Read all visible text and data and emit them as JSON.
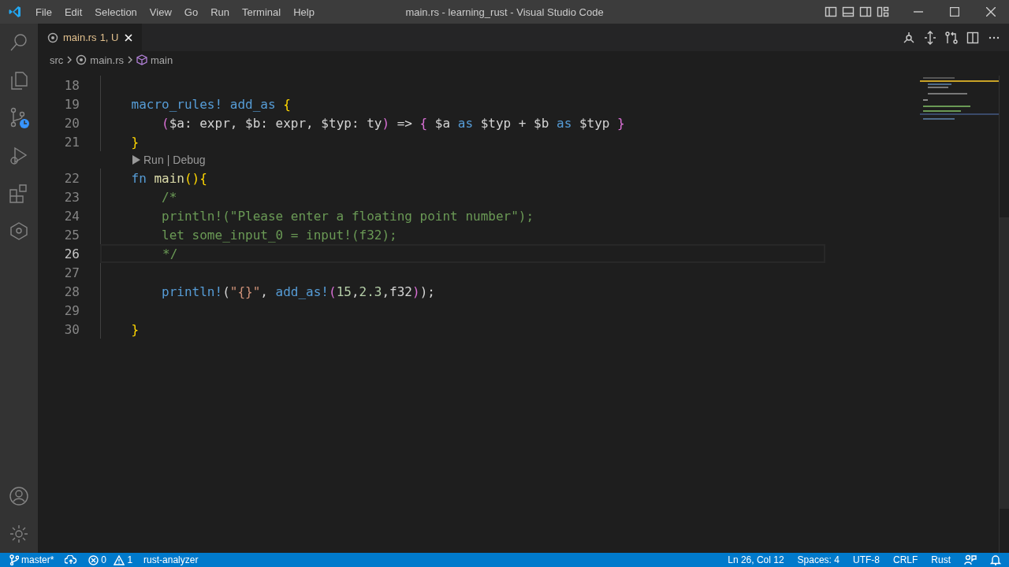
{
  "window": {
    "title": "main.rs - learning_rust - Visual Studio Code"
  },
  "menu": [
    "File",
    "Edit",
    "Selection",
    "View",
    "Go",
    "Run",
    "Terminal",
    "Help"
  ],
  "activity_bar": {
    "top": [
      {
        "kind": "search"
      },
      {
        "kind": "files"
      },
      {
        "kind": "scm"
      },
      {
        "kind": "debug"
      },
      {
        "kind": "extensions"
      },
      {
        "kind": "remote"
      }
    ],
    "bottom": [
      {
        "kind": "account"
      },
      {
        "kind": "settings"
      }
    ]
  },
  "tabs": [
    {
      "filename": "main.rs",
      "badge": "1, U",
      "selected": true
    }
  ],
  "breadcrumbs": [
    "src",
    "main.rs",
    "main"
  ],
  "editor": {
    "lines": [
      {
        "kind": "code",
        "number": "18",
        "current": false
      },
      {
        "kind": "code",
        "number": "19",
        "current": false,
        "tokens": [
          {
            "text": "    macro_rules! ",
            "kind": "macro"
          },
          {
            "text": "add_as ",
            "kind": "macro"
          },
          {
            "text": "{",
            "kind": "b1"
          }
        ]
      },
      {
        "kind": "code",
        "number": "20",
        "current": false,
        "tokens": [
          {
            "text": "        (",
            "kind": "b2"
          },
          {
            "text": "$a: expr, $b: expr, $typ: ty",
            "kind": "plain"
          },
          {
            "text": ")",
            "kind": "b2"
          },
          {
            "text": " => ",
            "kind": "plain"
          },
          {
            "text": "{",
            "kind": "b2"
          },
          {
            "text": " $a ",
            "kind": "plain"
          },
          {
            "text": "as",
            "kind": "kw"
          },
          {
            "text": " $typ + $b ",
            "kind": "plain"
          },
          {
            "text": "as",
            "kind": "kw"
          },
          {
            "text": " $typ ",
            "kind": "plain"
          },
          {
            "text": "}",
            "kind": "b2"
          }
        ]
      },
      {
        "kind": "code",
        "number": "21",
        "current": false,
        "tokens": [
          {
            "text": "    }",
            "kind": "b1"
          }
        ]
      },
      {
        "kind": "codelens",
        "run": "Run",
        "separator": "|",
        "debug": "Debug"
      },
      {
        "kind": "code",
        "number": "22",
        "current": false,
        "tokens": [
          {
            "text": "    fn ",
            "kind": "kw"
          },
          {
            "text": "main",
            "kind": "func"
          },
          {
            "text": "(){",
            "kind": "b1"
          }
        ]
      },
      {
        "kind": "code",
        "number": "23",
        "current": false,
        "tokens": [
          {
            "text": "        /*",
            "kind": "comment"
          }
        ]
      },
      {
        "kind": "code",
        "number": "24",
        "current": false,
        "tokens": [
          {
            "text": "        println!(\"Please enter a floating point number\");",
            "kind": "comment"
          }
        ]
      },
      {
        "kind": "code",
        "number": "25",
        "current": false,
        "tokens": [
          {
            "text": "        let some_input_0 = input!(f32);",
            "kind": "comment"
          }
        ]
      },
      {
        "kind": "code",
        "number": "26",
        "current": true,
        "tokens": [
          {
            "text": "        */",
            "kind": "comment"
          }
        ]
      },
      {
        "kind": "code",
        "number": "27",
        "current": false
      },
      {
        "kind": "code",
        "number": "28",
        "current": false,
        "tokens": [
          {
            "text": "        println!",
            "kind": "macro"
          },
          {
            "text": "(",
            "kind": "plain"
          },
          {
            "text": "\"{}\"",
            "kind": "string"
          },
          {
            "text": ", ",
            "kind": "plain"
          },
          {
            "text": "add_as!",
            "kind": "macro"
          },
          {
            "text": "(",
            "kind": "b2"
          },
          {
            "text": "15",
            "kind": "number"
          },
          {
            "text": ",",
            "kind": "plain"
          },
          {
            "text": "2.3",
            "kind": "number"
          },
          {
            "text": ",f32",
            "kind": "plain"
          },
          {
            "text": ")",
            "kind": "b2"
          },
          {
            "text": ");",
            "kind": "plain"
          }
        ]
      },
      {
        "kind": "code",
        "number": "29",
        "current": false
      },
      {
        "kind": "code",
        "number": "30",
        "current": false,
        "tokens": [
          {
            "text": "    }",
            "kind": "b1"
          }
        ]
      }
    ]
  },
  "status_bar": {
    "left": [
      {
        "kind": "branch",
        "text": "master*"
      },
      {
        "kind": "sync"
      },
      {
        "kind": "problems",
        "errors": "0",
        "warnings": "1"
      },
      {
        "kind": "text",
        "text": "rust-analyzer"
      }
    ],
    "right": [
      {
        "kind": "text",
        "text": "Ln 26, Col 12"
      },
      {
        "kind": "text",
        "text": "Spaces: 4"
      },
      {
        "kind": "text",
        "text": "UTF-8"
      },
      {
        "kind": "text",
        "text": "CRLF"
      },
      {
        "kind": "text",
        "text": "Rust"
      },
      {
        "kind": "feedback"
      },
      {
        "kind": "bell"
      }
    ]
  }
}
